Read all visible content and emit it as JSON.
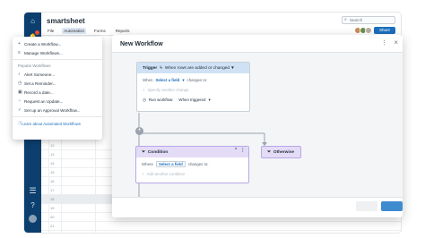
{
  "app": {
    "brand": "smartsheet",
    "search_placeholder": "Search",
    "menus": [
      "File",
      "Automation",
      "Forms",
      "Reports"
    ],
    "active_menu": "Automation",
    "share_label": "Share"
  },
  "grid": {
    "row_numbers": [
      "12",
      "13",
      "14",
      "15",
      "16",
      "17",
      "18",
      "19",
      "20",
      "21"
    ]
  },
  "dropdown": {
    "items_top": [
      {
        "icon": "plus-icon",
        "label": "Create a Workflow..."
      },
      {
        "icon": "list-icon",
        "label": "Manage Workflows..."
      }
    ],
    "section_header": "Popular Workflows",
    "items_popular": [
      {
        "icon": "bell-icon",
        "label": "Alert Someone..."
      },
      {
        "icon": "clock-icon",
        "label": "Set a Reminder..."
      },
      {
        "icon": "lock-icon",
        "label": "Record a date..."
      },
      {
        "icon": "request-icon",
        "label": "Request an Update..."
      },
      {
        "icon": "approval-icon",
        "label": "Set up an Approval Workflow..."
      }
    ],
    "learn_link": "Learn about Automated Workflows"
  },
  "modal": {
    "title": "New Workflow",
    "trigger": {
      "title_prefix": "Trigger",
      "trigger_select": "When rows are added or changed",
      "when_label": "When",
      "field_select": "Select a field",
      "changes_to": "changes to:",
      "faded_row": "Specify another change",
      "run_label": "Run workflow:",
      "run_select": "When triggered"
    },
    "condition": {
      "title": "Condition",
      "where_label": "Where",
      "field_select": "Select a field",
      "changes_to": "changes to:",
      "faded_row": "Add another condition"
    },
    "otherwise": {
      "title": "Otherwise"
    }
  },
  "colors": {
    "sidebar": "#0c3f6e",
    "accent": "#1b6fbd",
    "trigger_header": "#cfe2f5",
    "condition_header": "#e4dcf7"
  }
}
